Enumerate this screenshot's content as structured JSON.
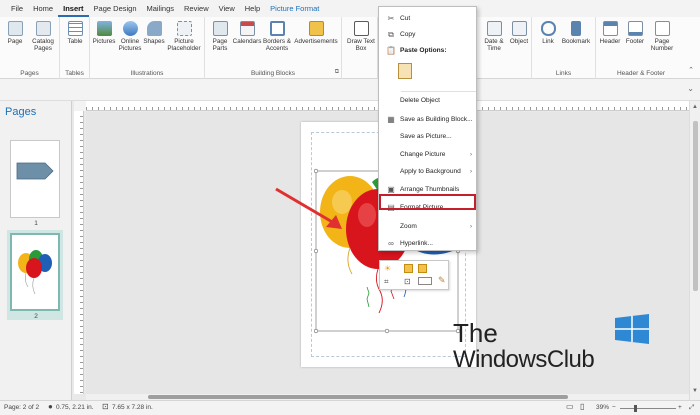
{
  "tabs": [
    {
      "label": "File"
    },
    {
      "label": "Home"
    },
    {
      "label": "Insert"
    },
    {
      "label": "Page Design"
    },
    {
      "label": "Mailings"
    },
    {
      "label": "Review"
    },
    {
      "label": "View"
    },
    {
      "label": "Help"
    },
    {
      "label": "Picture Format"
    }
  ],
  "ribbon": {
    "groups": {
      "pages": "Pages",
      "tables": "Tables",
      "illustrations": "Illustrations",
      "building_blocks": "Building Blocks",
      "links": "Links",
      "header_footer": "Header & Footer"
    },
    "buttons": {
      "page": "Page",
      "catalog_pages": "Catalog Pages",
      "table": "Table",
      "pictures": "Pictures",
      "online_pictures": "Online Pictures",
      "shapes": "Shapes",
      "picture_placeholder": "Picture Placeholder",
      "page_parts": "Page Parts",
      "calendars": "Calendars",
      "borders_accents": "Borders & Accents",
      "advertisements": "Advertisements",
      "draw_text_box": "Draw Text Box",
      "date_time": "Date & Time",
      "object": "Object",
      "link": "Link",
      "bookmark": "Bookmark",
      "header": "Header",
      "footer": "Footer",
      "page_number": "Page Number"
    }
  },
  "pages_pane": {
    "title": "Pages",
    "thumbs": [
      {
        "num": "1"
      },
      {
        "num": "2"
      }
    ]
  },
  "context_menu": {
    "items": [
      {
        "label": "Cut",
        "icon": "scissors-icon"
      },
      {
        "label": "Copy",
        "icon": "copy-icon"
      },
      {
        "label": "Paste Options:",
        "icon": "paste-icon"
      },
      {
        "label": "Delete Object"
      },
      {
        "label": "Save as Building Block...",
        "icon": "building-block-icon"
      },
      {
        "label": "Save as Picture..."
      },
      {
        "label": "Change Picture"
      },
      {
        "label": "Apply to Background"
      },
      {
        "label": "Arrange Thumbnails",
        "icon": "thumbnails-icon"
      },
      {
        "label": "Format Picture...",
        "icon": "format-picture-icon"
      },
      {
        "label": "Zoom"
      },
      {
        "label": "Hyperlink...",
        "icon": "hyperlink-icon"
      }
    ]
  },
  "status": {
    "page": "Page: 2 of 2",
    "position": "0.75, 2.21 in.",
    "size": "7.65 x 7.28 in.",
    "zoom": "39%"
  },
  "watermark": {
    "line1": "The",
    "line2": "WindowsClub"
  },
  "colors": {
    "accent": "#1d6fb8",
    "highlight_red": "#c61e2b",
    "arrow_red": "#e03030",
    "balloon_yellow": "#f2b417",
    "balloon_red": "#d8141d",
    "balloon_blue": "#1f5fb5",
    "balloon_green": "#2a9a3a",
    "shape_gray_blue": "#6e8fa8"
  }
}
